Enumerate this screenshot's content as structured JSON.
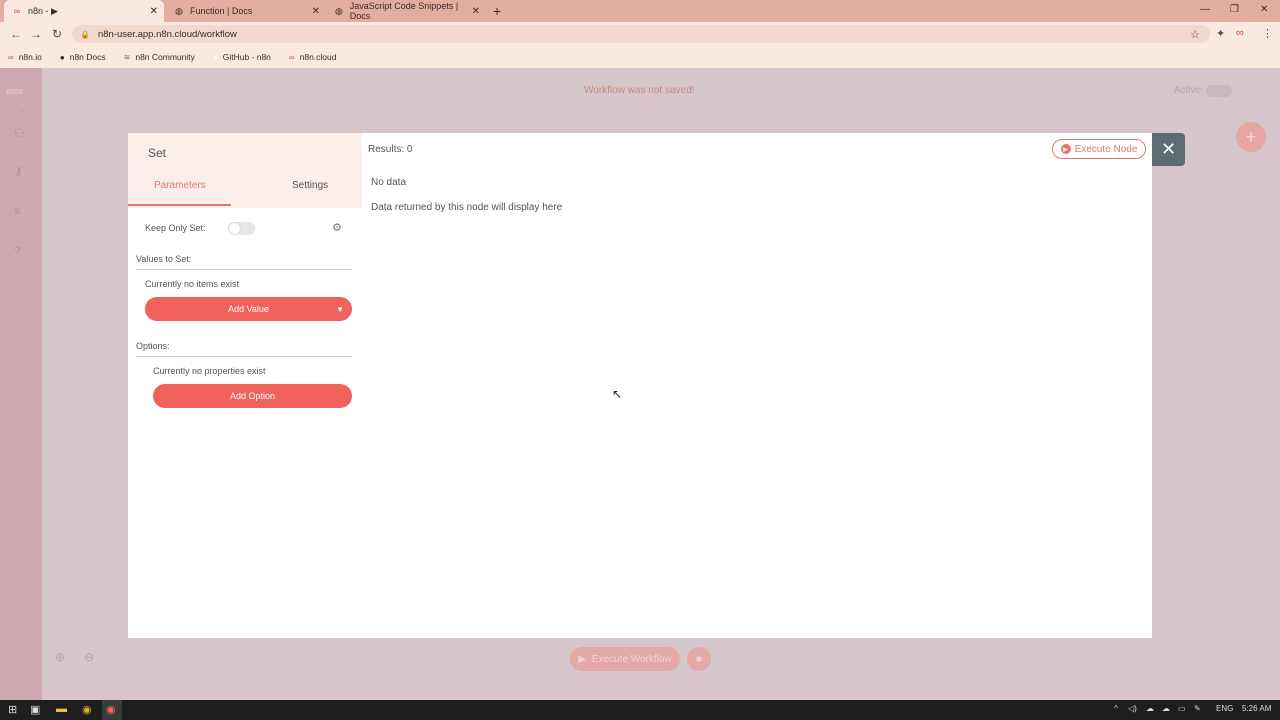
{
  "browser": {
    "tabs": [
      {
        "label": "n8n - ▶",
        "active": true
      },
      {
        "label": "Function | Docs",
        "active": false
      },
      {
        "label": "JavaScript Code Snippets | Docs",
        "active": false
      }
    ],
    "url": "n8n-user.app.n8n.cloud/workflow",
    "bookmarks": [
      "n8n.io",
      "n8n Docs",
      "n8n Community",
      "GitHub - n8n",
      "n8n.cloud"
    ]
  },
  "app": {
    "workflow_title": "Workflow was not saved!",
    "active_label": "Active:",
    "execute_workflow_label": "Execute Workflow"
  },
  "modal": {
    "node_name": "Set",
    "tabs": {
      "parameters": "Parameters",
      "settings": "Settings"
    },
    "keep_only_set_label": "Keep Only Set:",
    "values_to_set_label": "Values to Set:",
    "values_empty": "Currently no items exist",
    "add_value_label": "Add Value",
    "options_label": "Options:",
    "options_empty": "Currently no properties exist",
    "add_option_label": "Add Option",
    "results_label": "Results: 0",
    "no_data": "No data",
    "no_data_sub": "Data returned by this node will display here",
    "execute_node_label": "Execute Node"
  },
  "taskbar": {
    "lang": "ENG",
    "time": "5:26 AM"
  },
  "colors": {
    "accent": "#f0625c",
    "accent_text": "#e2786c",
    "close_bg": "#5f6b72"
  }
}
